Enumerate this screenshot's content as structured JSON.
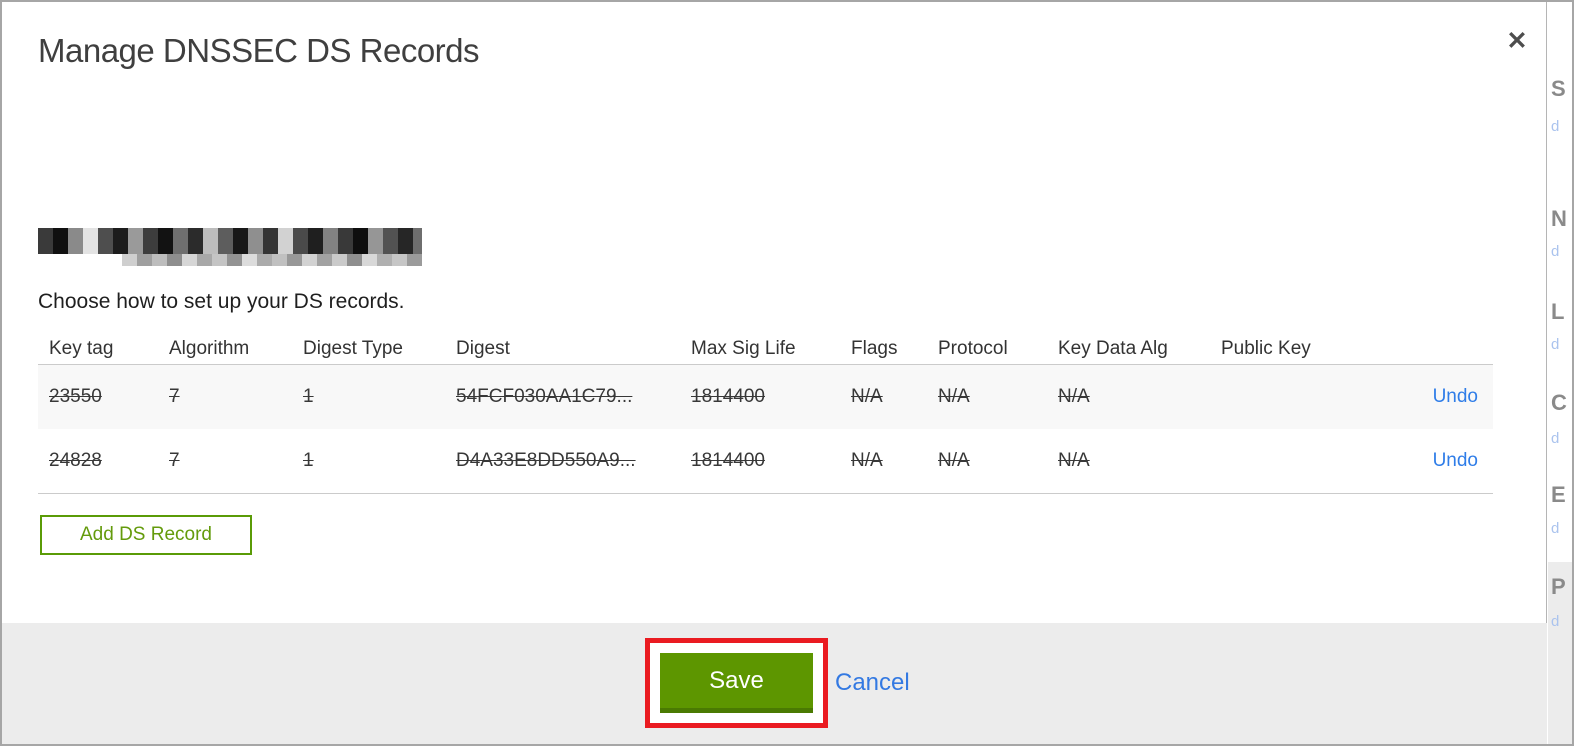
{
  "modal": {
    "title": "Manage DNSSEC DS Records",
    "close_icon": "✕",
    "intro": "Choose how to set up your DS records.",
    "table": {
      "headers": [
        "Key tag",
        "Algorithm",
        "Digest Type",
        "Digest",
        "Max Sig Life",
        "Flags",
        "Protocol",
        "Key Data Alg",
        "Public Key"
      ],
      "rows": [
        {
          "key_tag": "23550",
          "algorithm": "7",
          "digest_type": "1",
          "digest": "54FCF030AA1C79...",
          "max_sig_life": "1814400",
          "flags": "N/A",
          "protocol": "N/A",
          "key_data_alg": "N/A",
          "public_key": "",
          "action": "Undo",
          "state": "marked-for-deletion"
        },
        {
          "key_tag": "24828",
          "algorithm": "7",
          "digest_type": "1",
          "digest": "D4A33E8DD550A9...",
          "max_sig_life": "1814400",
          "flags": "N/A",
          "protocol": "N/A",
          "key_data_alg": "N/A",
          "public_key": "",
          "action": "Undo",
          "state": "marked-for-deletion"
        }
      ]
    },
    "add_button_label": "Add DS Record",
    "footer": {
      "save_label": "Save",
      "cancel_label": "Cancel"
    }
  },
  "background_strip": {
    "letters": [
      "S",
      "N",
      "L",
      "C",
      "E",
      "P"
    ],
    "link_fragments": [
      "d",
      "d",
      "d",
      "d",
      "d",
      "d"
    ]
  },
  "colors": {
    "save_green": "#5d9600",
    "add_record_green": "#649b0c",
    "annotation_red": "#ea1b21",
    "link_blue": "#2f7de8",
    "footer_gray": "#ececec"
  }
}
